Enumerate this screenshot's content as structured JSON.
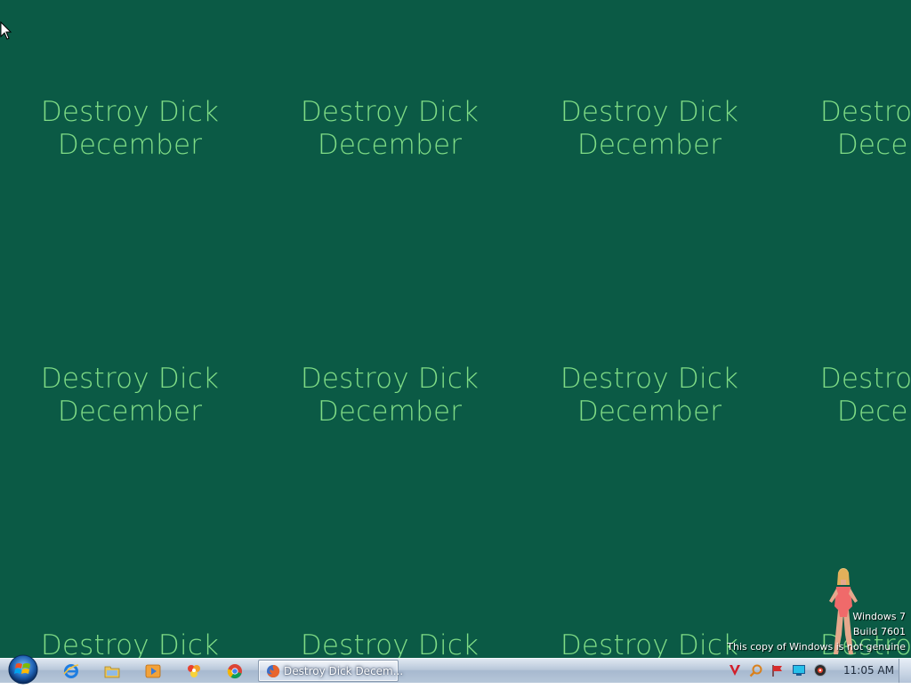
{
  "desktop": {
    "background_color": "#0b5a45",
    "text_color": "#7fdc86",
    "wallpaper_text": {
      "line1": "Destroy Dick",
      "line2": "December"
    },
    "watermark": {
      "line1": "Windows 7",
      "line2": "Build 7601",
      "line3": "This copy of Windows is not genuine"
    }
  },
  "taskbar": {
    "start_icon": "windows-orb-icon",
    "pinned": [
      {
        "name": "internet-explorer-icon"
      },
      {
        "name": "windows-explorer-icon"
      },
      {
        "name": "media-player-icon"
      },
      {
        "name": "colorful-app-icon"
      },
      {
        "name": "chrome-icon"
      }
    ],
    "active_task": {
      "icon": "firefox-icon",
      "label": "Destroy Dick Decem..."
    },
    "tray_icons": [
      "vivaldi-icon",
      "search-tray-icon",
      "flag-icon",
      "network-icon",
      "volume-icon"
    ],
    "clock": "11:05 AM"
  }
}
